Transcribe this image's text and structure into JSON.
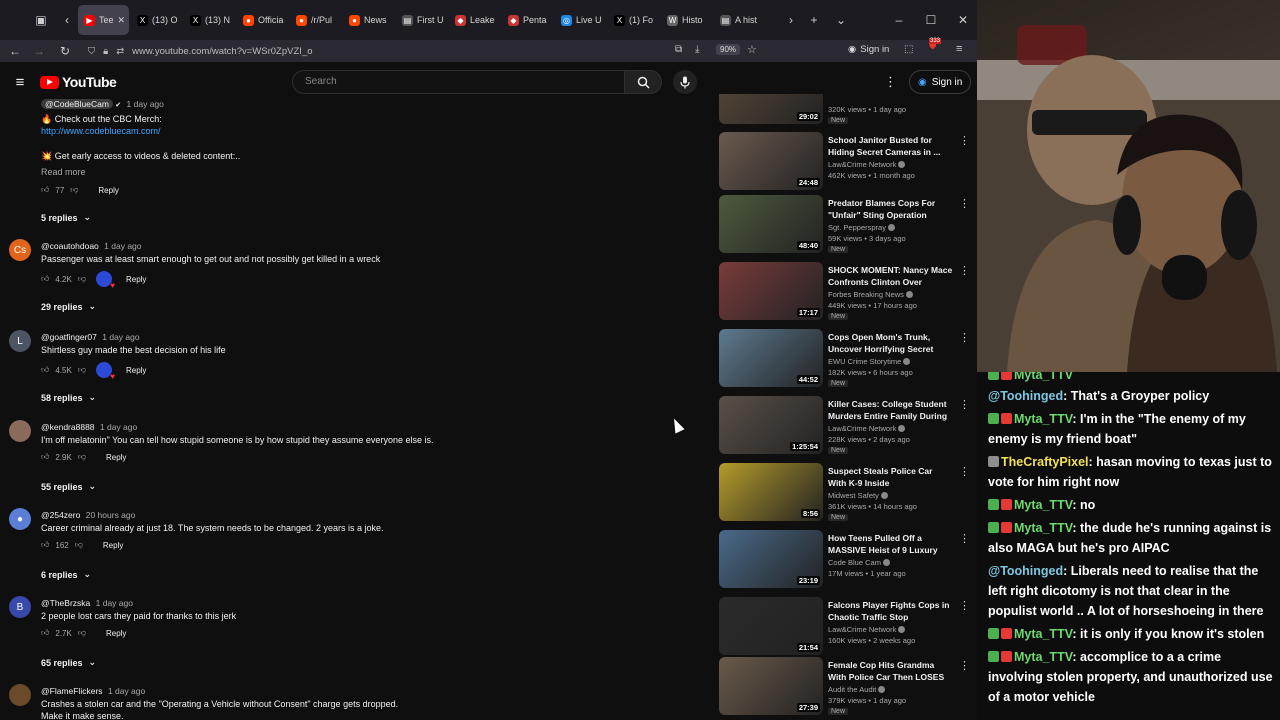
{
  "browser": {
    "tabs": [
      {
        "label": "Tee",
        "favicon": "youtube",
        "active": true
      },
      {
        "label": "(13) O",
        "favicon": "x"
      },
      {
        "label": "(13) N",
        "favicon": "x"
      },
      {
        "label": "Officia",
        "favicon": "reddit"
      },
      {
        "label": "/r/Pul",
        "favicon": "reddit"
      },
      {
        "label": "News",
        "favicon": "reddit"
      },
      {
        "label": "First U",
        "favicon": "page"
      },
      {
        "label": "Leake",
        "favicon": "red"
      },
      {
        "label": "Penta",
        "favicon": "red"
      },
      {
        "label": "Live U",
        "favicon": "globe"
      },
      {
        "label": "(1) Fo",
        "favicon": "x"
      },
      {
        "label": "Histo",
        "favicon": "wiki"
      },
      {
        "label": "A hist",
        "favicon": "page"
      }
    ],
    "url": "www.youtube.com/watch?v=WSr0ZpVZI_o",
    "zoom": "90%",
    "signin_label": "Sign in",
    "badge_count": "333"
  },
  "youtube": {
    "logo_text": "YouTube",
    "search_placeholder": "Search",
    "signin_label": "Sign in"
  },
  "comments": [
    {
      "handle": "@CodeBlueCam",
      "time": "1 day ago",
      "lines": [
        "🔥 Check out the CBC Merch:",
        "http://www.codebluecam.com/",
        "💥 Get early access to videos & deleted content:.."
      ],
      "read_more": "Read more",
      "likes": "77",
      "reply_label": "Reply",
      "replies": "5 replies"
    },
    {
      "handle": "@coautohdoao",
      "time": "1 day ago",
      "text": "Passenger was at least smart enough to get out and not possibly get killed in a wreck",
      "likes": "4.2K",
      "reply_label": "Reply",
      "replies": "29 replies",
      "avatar_letter": "Cs",
      "avatar_color": "#e0641c"
    },
    {
      "handle": "@goatfinger07",
      "time": "1 day ago",
      "text": "Shirtless guy made the best decision of his life",
      "likes": "4.5K",
      "reply_label": "Reply",
      "replies": "58 replies",
      "avatar_letter": "L",
      "avatar_color": "#4b5563"
    },
    {
      "handle": "@kendra8888",
      "time": "1 day ago",
      "text": "I'm off melatonin\" You can tell how stupid someone is by how stupid they assume everyone else is.",
      "likes": "2.9K",
      "reply_label": "Reply",
      "replies": "55 replies"
    },
    {
      "handle": "@254zero",
      "time": "20 hours ago",
      "text": "Career criminal already at just 18. The system needs to be changed. 2 years is a joke.",
      "likes": "162",
      "reply_label": "Reply",
      "replies": "6 replies"
    },
    {
      "handle": "@TheBrzska",
      "time": "1 day ago",
      "text": "2 people lost cars they paid for thanks to this jerk",
      "likes": "2.7K",
      "reply_label": "Reply",
      "replies": "65 replies",
      "avatar_letter": "B",
      "avatar_color": "#3949ab"
    },
    {
      "handle": "@FlameFlickers",
      "time": "1 day ago",
      "text": "Crashes a stolen car and the \"Operating a Vehicle without Consent\" charge gets dropped.",
      "text2": "Make it make sense."
    }
  ],
  "sidebar": [
    {
      "title": "",
      "channel": "",
      "meta": "320K views • 1 day ago",
      "badge": "New",
      "duration": "29:02",
      "thumb": "#5a4a3a"
    },
    {
      "title": "School Janitor Busted for Hiding Secret Cameras in ...",
      "channel": "Law&Crime Network",
      "meta": "462K views • 1 month ago",
      "badge": "",
      "duration": "24:48",
      "thumb": "#6b5a4e"
    },
    {
      "title": "Predator Blames Cops For \"Unfair\" Sting Operation",
      "channel": "Sgt. Pepperspray",
      "meta": "59K views • 3 days ago",
      "badge": "New",
      "duration": "48:40",
      "thumb": "#4d5a3e"
    },
    {
      "title": "SHOCK MOMENT: Nancy Mace Confronts Clinton Over Epstei...",
      "channel": "Forbes Breaking News",
      "meta": "449K views • 17 hours ago",
      "badge": "New",
      "duration": "17:17",
      "thumb": "#7a3b3b"
    },
    {
      "title": "Cops Open Mom's Trunk, Uncover Horrifying Secret",
      "channel": "EWU Crime Storytime",
      "meta": "182K views • 6 hours ago",
      "badge": "New",
      "duration": "44:52",
      "thumb": "#5d7a8f"
    },
    {
      "title": "Killer Cases: College Student Murders Entire Family During ...",
      "channel": "Law&Crime Network",
      "meta": "228K views • 2 days ago",
      "badge": "New",
      "duration": "1:25:54",
      "thumb": "#5a5048"
    },
    {
      "title": "Suspect Steals Police Car With K-9 Inside",
      "channel": "Midwest Safety",
      "meta": "361K views • 14 hours ago",
      "badge": "New",
      "duration": "8:56",
      "thumb": "#b59a2a"
    },
    {
      "title": "How Teens Pulled Off a MASSIVE Heist of 9 Luxury Cars",
      "channel": "Code Blue Cam",
      "meta": "17M views • 1 year ago",
      "badge": "",
      "duration": "23:19",
      "thumb": "#4a6a8a"
    },
    {
      "title": "Falcons Player Fights Cops in Chaotic Traffic Stop",
      "channel": "Law&Crime Network",
      "meta": "160K views • 2 weeks ago",
      "badge": "",
      "duration": "21:54",
      "thumb": "#2a2a2a"
    },
    {
      "title": "Female Cop Hits Grandma With Police Car Then LOSES IT On ...",
      "channel": "Audit the Audit",
      "meta": "379K views • 1 day ago",
      "badge": "New",
      "duration": "27:39",
      "thumb": "#6a5a4a"
    }
  ],
  "chat": [
    {
      "user": "Myta_TTV",
      "text": "",
      "color": "#6fd96f"
    },
    {
      "user": "@Toohinged",
      "text": ": That's a Groyper policy",
      "color": "#7ec8e3"
    },
    {
      "user": "Myta_TTV",
      "text": ": I'm in the \"The enemy of my enemy is my friend boat\"",
      "color": "#6fd96f"
    },
    {
      "user": "TheCraftyPixel",
      "text": ": hasan moving to texas just to vote for him right now",
      "color": "#f1e05a"
    },
    {
      "user": "Myta_TTV",
      "text": ": no",
      "color": "#6fd96f"
    },
    {
      "user": "Myta_TTV",
      "text": ": the dude he's running against is also MAGA but he's pro AIPAC",
      "color": "#6fd96f"
    },
    {
      "user": "@Toohinged",
      "text": ": Liberals need to realise that the left right dicotomy is not that clear in the populist world .. A lot of horseshoeing in there",
      "color": "#7ec8e3"
    },
    {
      "user": "Myta_TTV",
      "text": ": it is only if you know it's stolen",
      "color": "#6fd96f"
    },
    {
      "user": "Myta_TTV",
      "text": ": accomplice to a a crime involving stolen property, and unauthorized use of a motor vehicle",
      "color": "#6fd96f"
    }
  ]
}
